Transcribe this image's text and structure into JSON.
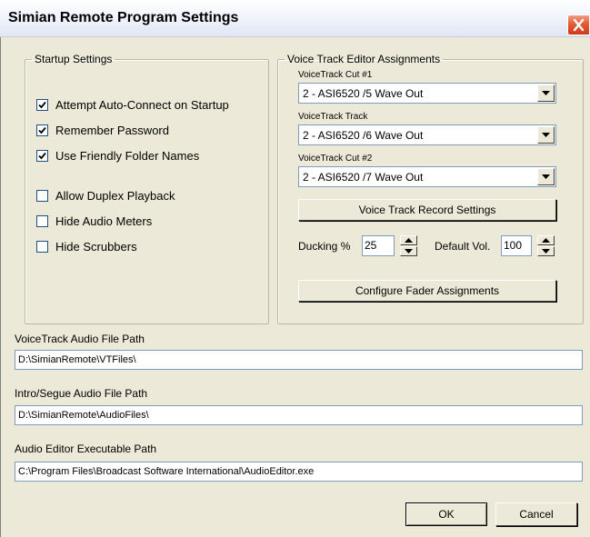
{
  "window": {
    "title": "Simian Remote Program Settings"
  },
  "startup": {
    "legend": "Startup Settings",
    "options": [
      {
        "label": "Attempt Auto-Connect on Startup",
        "checked": true
      },
      {
        "label": "Remember Password",
        "checked": true
      },
      {
        "label": "Use Friendly Folder Names",
        "checked": true
      },
      {
        "label": "Allow Duplex Playback",
        "checked": false
      },
      {
        "label": "Hide Audio Meters",
        "checked": false
      },
      {
        "label": "Hide Scrubbers",
        "checked": false
      }
    ]
  },
  "voice": {
    "legend": "Voice Track Editor Assignments",
    "assignments": [
      {
        "label": "VoiceTrack Cut #1",
        "value": "2 - ASI6520 /5 Wave Out"
      },
      {
        "label": "VoiceTrack Track",
        "value": "2 - ASI6520 /6 Wave Out"
      },
      {
        "label": "VoiceTrack Cut #2",
        "value": "2 - ASI6520 /7 Wave Out"
      }
    ],
    "record_settings_button": "Voice Track Record Settings",
    "ducking_label": "Ducking %",
    "ducking_value": "25",
    "default_vol_label": "Default Vol.",
    "default_vol_value": "100",
    "fader_button": "Configure Fader Assignments"
  },
  "paths": {
    "voicetrack": {
      "label": "VoiceTrack Audio File Path",
      "value": "D:\\SimianRemote\\VTFiles\\"
    },
    "intro": {
      "label": "Intro/Segue Audio File Path",
      "value": "D:\\SimianRemote\\AudioFiles\\"
    },
    "editor": {
      "label": "Audio Editor Executable Path",
      "value": "C:\\Program Files\\Broadcast Software International\\AudioEditor.exe"
    }
  },
  "buttons": {
    "ok": "OK",
    "cancel": "Cancel"
  },
  "icons": {
    "close": "close-icon",
    "check": "check-icon",
    "dropdown": "chevron-down-icon",
    "spin_up": "arrow-up-icon",
    "spin_down": "arrow-down-icon"
  },
  "colors": {
    "close_button": "#e35c38",
    "input_border": "#7f9db9",
    "face": "#ece9d8"
  }
}
